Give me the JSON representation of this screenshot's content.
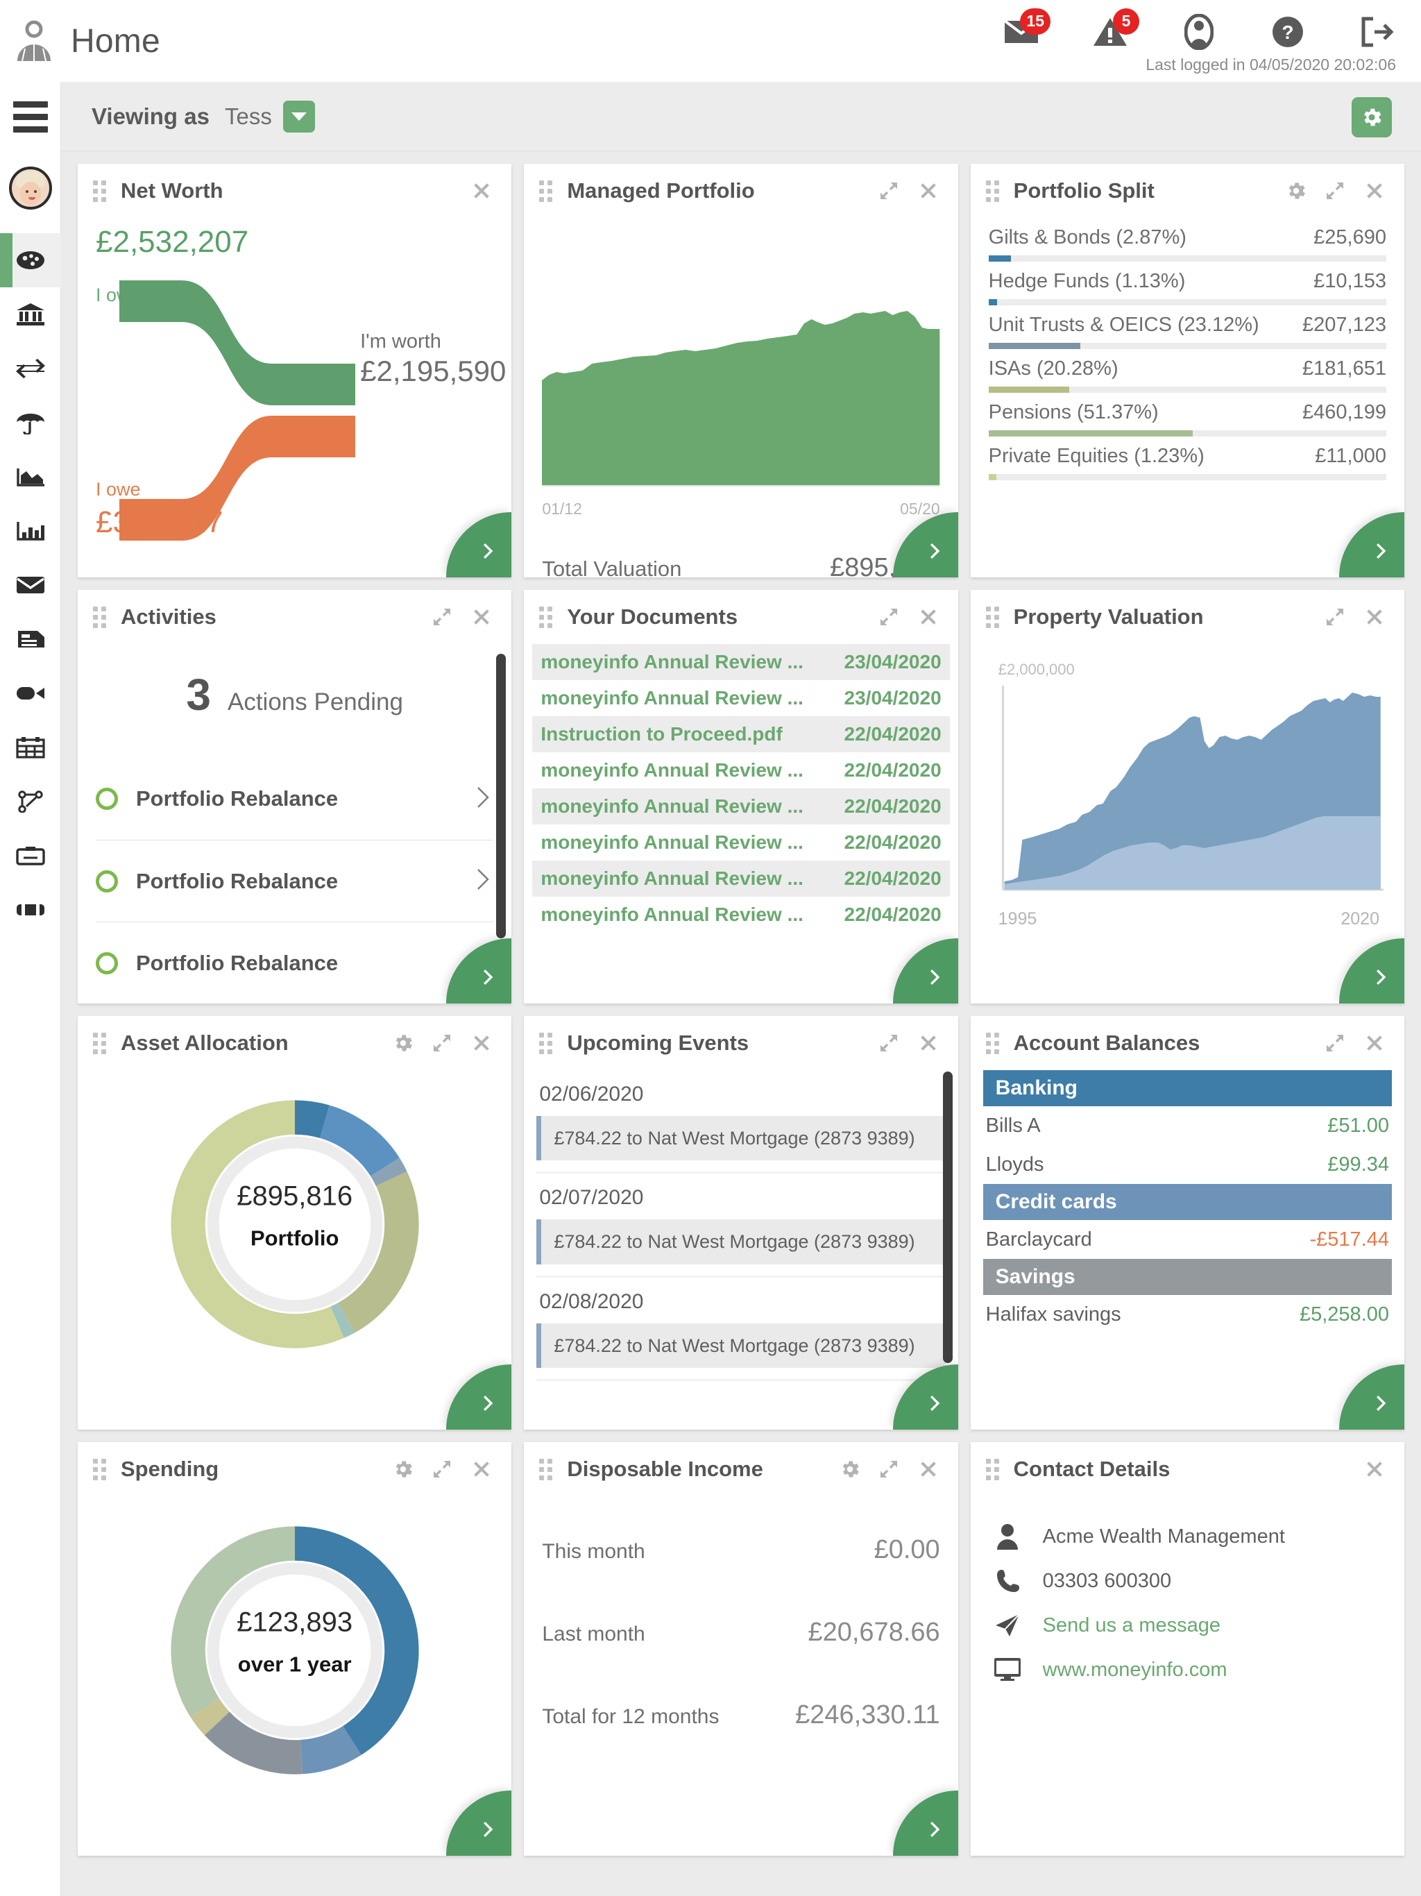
{
  "header": {
    "page_title": "Home",
    "mail_badge": "15",
    "alert_badge": "5",
    "last_login": "Last logged in 04/05/2020 20:02:06",
    "icons": [
      "mail-icon",
      "alert-icon",
      "account-icon",
      "help-icon",
      "logout-icon"
    ]
  },
  "viewbar": {
    "label": "Viewing as",
    "value": "Tess"
  },
  "sidebar": {
    "items": [
      {
        "icon": "dashboard-icon",
        "active": true
      },
      {
        "icon": "bank-icon",
        "active": false
      },
      {
        "icon": "transfer-icon",
        "active": false
      },
      {
        "icon": "umbrella-icon",
        "active": false
      },
      {
        "icon": "area-chart-icon",
        "active": false
      },
      {
        "icon": "bar-chart-icon",
        "active": false
      },
      {
        "icon": "envelope-icon",
        "active": false
      },
      {
        "icon": "document-icon",
        "active": false
      },
      {
        "icon": "video-icon",
        "active": false
      },
      {
        "icon": "calendar-icon",
        "active": false
      },
      {
        "icon": "org-chart-icon",
        "active": false
      },
      {
        "icon": "card-icon",
        "active": false
      },
      {
        "icon": "briefcase-icon",
        "active": false
      }
    ]
  },
  "colors": {
    "brand_green": "#6aab76",
    "go_green": "#4e9a63",
    "own_green": "#5f9e6d",
    "owe_orange": "#e5794a",
    "link_green": "#6aa870",
    "badge_red": "#e52323"
  },
  "cards": {
    "net_worth": {
      "title": "Net Worth",
      "own_value": "£2,532,207",
      "own_label": "I own",
      "owe_label": "I owe",
      "owe_value": "£336,617",
      "worth_label": "I'm worth",
      "worth_value": "£2,195,590"
    },
    "managed_portfolio": {
      "title": "Managed Portfolio",
      "axis_start": "01/12",
      "axis_end": "05/20",
      "total_label": "Total Valuation",
      "total_value": "£895,816"
    },
    "portfolio_split": {
      "title": "Portfolio Split",
      "rows": [
        {
          "label": "Gilts & Bonds (2.87%)",
          "amount": "£25,690",
          "pct": 5.6,
          "color": "#3d7da8"
        },
        {
          "label": "Hedge Funds (1.13%)",
          "amount": "£10,153",
          "pct": 2.2,
          "color": "#3d7da8"
        },
        {
          "label": "Unit Trusts & OEICS (23.12%)",
          "amount": "£207,123",
          "pct": 23.1,
          "color": "#7f93a6"
        },
        {
          "label": "ISAs (20.28%)",
          "amount": "£181,651",
          "pct": 20.3,
          "color": "#b8bd86"
        },
        {
          "label": "Pensions (51.37%)",
          "amount": "£460,199",
          "pct": 51.4,
          "color": "#a6bd93"
        },
        {
          "label": "Private Equities (1.23%)",
          "amount": "£11,000",
          "pct": 2.0,
          "color": "#cdd096"
        }
      ]
    },
    "activities": {
      "title": "Activities",
      "count": "3",
      "count_label": "Actions Pending",
      "rows": [
        {
          "label": "Portfolio Rebalance"
        },
        {
          "label": "Portfolio Rebalance"
        },
        {
          "label": "Portfolio Rebalance"
        }
      ]
    },
    "documents": {
      "title": "Your Documents",
      "rows": [
        {
          "name": "moneyinfo Annual Review ...",
          "date": "23/04/2020"
        },
        {
          "name": "moneyinfo Annual Review ...",
          "date": "23/04/2020"
        },
        {
          "name": "Instruction to Proceed.pdf",
          "date": "22/04/2020"
        },
        {
          "name": "moneyinfo Annual Review ...",
          "date": "22/04/2020"
        },
        {
          "name": "moneyinfo Annual Review ...",
          "date": "22/04/2020"
        },
        {
          "name": "moneyinfo Annual Review ...",
          "date": "22/04/2020"
        },
        {
          "name": "moneyinfo Annual Review ...",
          "date": "22/04/2020"
        },
        {
          "name": "moneyinfo Annual Review ...",
          "date": "22/04/2020"
        }
      ]
    },
    "property_valuation": {
      "title": "Property Valuation",
      "y_max_label": "£2,000,000",
      "axis_start": "1995",
      "axis_end": "2020"
    },
    "asset_allocation": {
      "title": "Asset Allocation",
      "center_value": "£895,816",
      "center_label": "Portfolio"
    },
    "upcoming_events": {
      "title": "Upcoming Events",
      "groups": [
        {
          "date": "02/06/2020",
          "item": "£784.22 to Nat West Mortgage (2873 9389)"
        },
        {
          "date": "02/07/2020",
          "item": "£784.22 to Nat West Mortgage (2873 9389)"
        },
        {
          "date": "02/08/2020",
          "item": "£784.22 to Nat West Mortgage (2873 9389)"
        }
      ]
    },
    "account_balances": {
      "title": "Account Balances",
      "sections": [
        {
          "heading": "Banking",
          "color": "#3d7da8",
          "rows": [
            {
              "name": "Bills A",
              "amount": "£51.00",
              "sign": "pos"
            },
            {
              "name": "Lloyds",
              "amount": "£99.34",
              "sign": "pos"
            }
          ]
        },
        {
          "heading": "Credit cards",
          "color": "#6d93b8",
          "rows": [
            {
              "name": "Barclaycard",
              "amount": "-£517.44",
              "sign": "neg"
            }
          ]
        },
        {
          "heading": "Savings",
          "color": "#94999e",
          "rows": [
            {
              "name": "Halifax savings",
              "amount": "£5,258.00",
              "sign": "pos"
            }
          ]
        }
      ]
    },
    "spending": {
      "title": "Spending",
      "center_value": "£123,893",
      "center_label": "over 1 year"
    },
    "disposable_income": {
      "title": "Disposable Income",
      "rows": [
        {
          "label": "This month",
          "value": "£0.00"
        },
        {
          "label": "Last month",
          "value": "£20,678.66"
        },
        {
          "label": "Total for 12 months",
          "value": "£246,330.11"
        }
      ]
    },
    "contact_details": {
      "title": "Contact Details",
      "rows": [
        {
          "icon": "person-icon",
          "text": "Acme Wealth Management",
          "link": false
        },
        {
          "icon": "phone-icon",
          "text": "03303 600300",
          "link": false
        },
        {
          "icon": "send-icon",
          "text": "Send us a message",
          "link": true
        },
        {
          "icon": "monitor-icon",
          "text": "www.moneyinfo.com",
          "link": true
        }
      ]
    }
  },
  "chart_data": [
    {
      "type": "area",
      "name": "managed-portfolio-trend",
      "title": "Managed Portfolio",
      "xlabel": "",
      "ylabel": "",
      "x": [
        "01/12",
        "05/20"
      ],
      "values": [
        58,
        60,
        62,
        61,
        63,
        64,
        66,
        67,
        67,
        68,
        69,
        69,
        70,
        70,
        71,
        71,
        72,
        73,
        73,
        73,
        74,
        74,
        75,
        76,
        77,
        78,
        78,
        79,
        79,
        80,
        80,
        81,
        82,
        83,
        84,
        86,
        88,
        89,
        90,
        90,
        91,
        92,
        93,
        94,
        95,
        95,
        96,
        97,
        98,
        99,
        100,
        99,
        98,
        97
      ],
      "color": "#6aa870",
      "grid": false,
      "legend": false
    },
    {
      "type": "bar",
      "name": "portfolio-split",
      "title": "Portfolio Split",
      "categories": [
        "Gilts & Bonds",
        "Hedge Funds",
        "Unit Trusts & OEICS",
        "ISAs",
        "Pensions",
        "Private Equities"
      ],
      "percentages": [
        2.87,
        1.13,
        23.12,
        20.28,
        51.37,
        1.23
      ],
      "values": [
        25690,
        10153,
        207123,
        181651,
        460199,
        11000
      ],
      "ylabel": "£",
      "colors": [
        "#3d7da8",
        "#3d7da8",
        "#7f93a6",
        "#b8bd86",
        "#a6bd93",
        "#cdd096"
      ]
    },
    {
      "type": "area",
      "name": "property-valuation",
      "title": "Property Valuation",
      "xlabel": "",
      "ylabel": "£",
      "x": [
        "1995",
        "2020"
      ],
      "ylim": [
        0,
        2000000
      ],
      "series": [
        {
          "name": "upper",
          "color": "#7ba0c0",
          "values": [
            30,
            31,
            33,
            34,
            36,
            38,
            40,
            43,
            46,
            48,
            50,
            54,
            58,
            62,
            66,
            70,
            68,
            67,
            66,
            65,
            64,
            63,
            62,
            61,
            62,
            64,
            66,
            69,
            72,
            75,
            78,
            80,
            82,
            84,
            86,
            88,
            90,
            88,
            87,
            89,
            91,
            90,
            92
          ]
        },
        {
          "name": "lower",
          "color": "#a9c1da",
          "values": [
            7,
            7,
            8,
            8,
            9,
            9,
            10,
            11,
            12,
            13,
            14,
            16,
            18,
            20,
            22,
            24,
            24,
            23,
            23,
            23,
            24,
            24,
            24,
            25,
            25,
            26,
            27,
            28,
            29,
            30,
            31,
            32,
            33,
            34,
            35,
            36,
            37,
            37,
            38,
            39,
            40,
            40,
            41
          ]
        }
      ],
      "grid": false,
      "legend": false
    },
    {
      "type": "pie",
      "name": "asset-allocation",
      "title": "Asset Allocation",
      "center_value": "£895,816",
      "center_label": "Portfolio",
      "slices": [
        {
          "label": "segment-1",
          "value": 4.5,
          "color": "#3d7da8"
        },
        {
          "label": "segment-2",
          "value": 11.5,
          "color": "#5b92c2"
        },
        {
          "label": "segment-3",
          "value": 2.0,
          "color": "#8ba3b5"
        },
        {
          "label": "segment-4",
          "value": 24.0,
          "color": "#b8bd8e"
        },
        {
          "label": "segment-5",
          "value": 1.5,
          "color": "#9fc4bd"
        },
        {
          "label": "segment-6",
          "value": 56.5,
          "color": "#cdd49c"
        }
      ]
    },
    {
      "type": "pie",
      "name": "spending",
      "title": "Spending",
      "center_value": "£123,893",
      "center_label": "over 1 year",
      "slices": [
        {
          "label": "segment-1",
          "value": 41.0,
          "color": "#3d7da8"
        },
        {
          "label": "segment-2",
          "value": 8.0,
          "color": "#6d93b8"
        },
        {
          "label": "segment-3",
          "value": 14.0,
          "color": "#8a939c"
        },
        {
          "label": "segment-4",
          "value": 3.0,
          "color": "#c8c494"
        },
        {
          "label": "segment-5",
          "value": 34.0,
          "color": "#b2c7ab"
        }
      ]
    }
  ]
}
